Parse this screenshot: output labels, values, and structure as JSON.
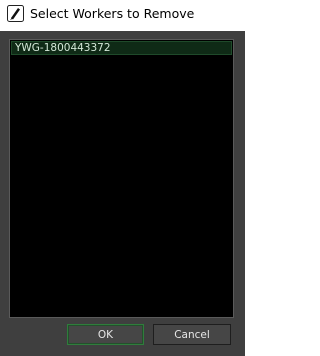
{
  "window": {
    "title": "Select Workers to Remove"
  },
  "list": {
    "items": [
      {
        "label": "YWG-1800443372",
        "selected": true
      }
    ]
  },
  "buttons": {
    "ok_label": "OK",
    "cancel_label": "Cancel"
  },
  "colors": {
    "client_bg": "#3f3f3f",
    "list_bg": "#000000",
    "selection_bg": "#0f2a16",
    "ok_border": "#2f7d3c"
  },
  "icons": {
    "app": "shotgun-pen-icon"
  }
}
